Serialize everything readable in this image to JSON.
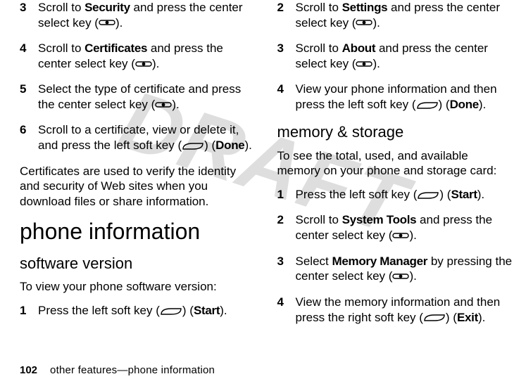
{
  "watermark": "DRAFT",
  "icon_center_name": "center-select-key-icon",
  "icon_softkey_name": "soft-key-icon",
  "left": {
    "steps_a": [
      {
        "n": "3",
        "pre": "Scroll to ",
        "bold": "Security",
        "post": " and press the center select key (",
        "tail": ")."
      },
      {
        "n": "4",
        "pre": "Scroll to ",
        "bold": "Certificates",
        "post": " and press the center select key (",
        "tail": ")."
      },
      {
        "n": "5",
        "pre": "Select the type of certificate and press the center select key (",
        "bold": "",
        "post": "",
        "tail": ")."
      },
      {
        "n": "6",
        "pre": "Scroll to a certificate, view or delete it, and press the left soft key (",
        "bold": "",
        "post": "",
        "tail_label": "Done",
        "tail": ")."
      }
    ],
    "para_cert": "Certificates are used to verify the identity and security of Web sites when you download files or share information.",
    "h1": "phone information",
    "h2": "software version",
    "intro_sw": "To view your phone software version:",
    "steps_b": [
      {
        "n": "1",
        "pre": "Press the left soft key (",
        "tail_label": "Start",
        "tail": ")."
      }
    ]
  },
  "right": {
    "steps_c": [
      {
        "n": "2",
        "pre": "Scroll to ",
        "bold": "Settings",
        "post": " and press the center select key (",
        "tail": ")."
      },
      {
        "n": "3",
        "pre": "Scroll to ",
        "bold": "About",
        "post": " and press the center select key (",
        "tail": ")."
      },
      {
        "n": "4",
        "pre": "View your phone information and then press the left soft key (",
        "tail_label": "Done",
        "tail": ")."
      }
    ],
    "h2_mem": "memory & storage",
    "intro_mem": "To see the total, used, and available memory on your phone and storage card:",
    "steps_d": [
      {
        "n": "1",
        "pre": "Press the left soft key (",
        "tail_label": "Start",
        "tail": ")."
      },
      {
        "n": "2",
        "pre": "Scroll to ",
        "bold": "System Tools",
        "post": " and press the center select key (",
        "tail": ")."
      },
      {
        "n": "3",
        "pre": "Select ",
        "bold": "Memory Manager",
        "post": " by pressing the center select key (",
        "tail": ")."
      },
      {
        "n": "4",
        "pre": "View the memory information and then press the right soft key (",
        "tail_label": "Exit",
        "tail": ")."
      }
    ]
  },
  "footer": {
    "page": "102",
    "section": "other features—phone information"
  }
}
